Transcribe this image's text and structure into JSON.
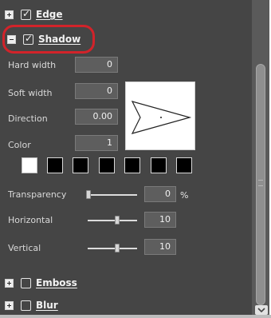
{
  "sections": {
    "edge": {
      "label": "Edge",
      "checked": true,
      "expanded": false
    },
    "shadow": {
      "label": "Shadow",
      "checked": true,
      "expanded": true
    },
    "emboss": {
      "label": "Emboss",
      "checked": false,
      "expanded": false
    },
    "blur": {
      "label": "Blur",
      "checked": false,
      "expanded": false
    }
  },
  "shadow_fields": {
    "hard_width": {
      "label": "Hard width",
      "value": "0"
    },
    "soft_width": {
      "label": "Soft width",
      "value": "0"
    },
    "direction": {
      "label": "Direction",
      "value": "0.00"
    },
    "color": {
      "label": "Color",
      "value": "1"
    }
  },
  "palette": {
    "swatches": [
      "#ffffff",
      "#000000",
      "#000000",
      "#000000",
      "#000000",
      "#000000",
      "#000000"
    ],
    "selected_index": 0
  },
  "sliders": {
    "transparency": {
      "label": "Transparency",
      "value": "0",
      "unit": "%",
      "fraction": 0.0
    },
    "horizontal": {
      "label": "Horizontal",
      "value": "10",
      "fraction": 0.55
    },
    "vertical": {
      "label": "Vertical",
      "value": "10",
      "fraction": 0.55
    }
  },
  "colors": {
    "panel_bg": "#454545",
    "highlight": "#d2232a"
  },
  "icons": {
    "collapse": "minus-square-icon",
    "expand": "plus-square-icon",
    "checkbox": "checkbox-icon",
    "scroll_down": "chevron-down-icon"
  }
}
